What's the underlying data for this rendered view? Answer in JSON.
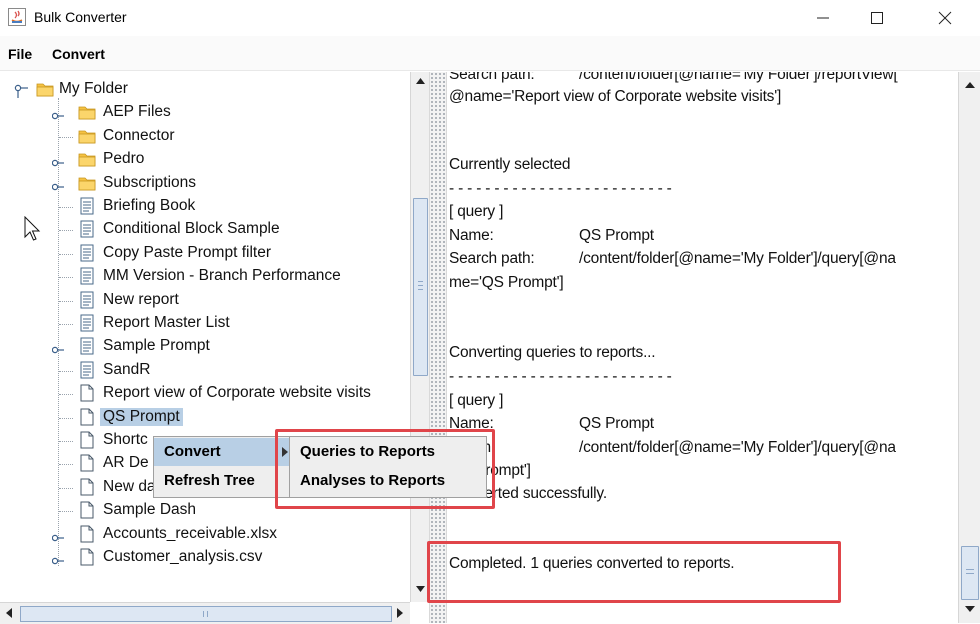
{
  "window": {
    "title": "Bulk Converter"
  },
  "menubar": {
    "file": "File",
    "convert": "Convert"
  },
  "tree": {
    "root": "My Folder",
    "items": [
      {
        "label": "AEP Files",
        "type": "folder",
        "expandable": true
      },
      {
        "label": "Connector",
        "type": "folder",
        "expandable": false
      },
      {
        "label": "Pedro",
        "type": "folder",
        "expandable": true
      },
      {
        "label": "Subscriptions",
        "type": "folder",
        "expandable": true
      },
      {
        "label": "Briefing Book",
        "type": "report",
        "expandable": false
      },
      {
        "label": "Conditional Block Sample",
        "type": "report",
        "expandable": false
      },
      {
        "label": "Copy Paste Prompt filter",
        "type": "report",
        "expandable": false
      },
      {
        "label": "MM Version - Branch Performance",
        "type": "report",
        "expandable": false
      },
      {
        "label": "New report",
        "type": "report",
        "expandable": false
      },
      {
        "label": "Report Master List",
        "type": "report",
        "expandable": false
      },
      {
        "label": "Sample Prompt",
        "type": "report",
        "expandable": true
      },
      {
        "label": "SandR",
        "type": "report",
        "expandable": false
      },
      {
        "label": "Report view of Corporate website visits",
        "type": "file",
        "expandable": false
      },
      {
        "label": "QS Prompt",
        "type": "file",
        "expandable": false,
        "selected": true
      },
      {
        "label": "Shortc",
        "type": "file",
        "expandable": false
      },
      {
        "label": "AR De",
        "type": "file",
        "expandable": false
      },
      {
        "label": "New dashboard",
        "type": "file",
        "expandable": false
      },
      {
        "label": "Sample Dash",
        "type": "file",
        "expandable": false
      },
      {
        "label": "Accounts_receivable.xlsx",
        "type": "file",
        "expandable": true
      },
      {
        "label": "Customer_analysis.csv",
        "type": "file",
        "expandable": true
      }
    ]
  },
  "context_menu": {
    "items": [
      "Convert",
      "Refresh Tree"
    ],
    "submenu": [
      "Queries to Reports",
      "Analyses to Reports"
    ]
  },
  "log": {
    "lines": [
      {
        "a": "Search path:",
        "b": "/content/folder[@name='My Folder']/reportView["
      },
      {
        "a": "@name='Report view of Corporate website visits']",
        "b": ""
      },
      {
        "a": "Currently selected",
        "b": ""
      },
      {
        "a": "- - - - - - - - - - - - - - - - - - - - - - - - -",
        "b": ""
      },
      {
        "a": "[ query ]",
        "b": ""
      },
      {
        "a": "Name:",
        "b": "QS Prompt"
      },
      {
        "a": "Search path:",
        "b": "/content/folder[@name='My Folder']/query[@na"
      },
      {
        "a": "me='QS Prompt']",
        "b": ""
      },
      {
        "a": "Converting queries to reports...",
        "b": ""
      },
      {
        "a": "- - - - - - - - - - - - - - - - - - - - - - - - -",
        "b": ""
      },
      {
        "a": "[ query ]",
        "b": ""
      },
      {
        "a": "Name:",
        "b": "QS Prompt"
      },
      {
        "a": "h path:",
        "b": "/content/folder[@name='My Folder']/query[@na"
      },
      {
        "a": "QS Prompt']",
        "b": ""
      },
      {
        "a": "Converted successfully.",
        "b": ""
      },
      {
        "a": "Completed. 1 queries converted to reports.",
        "b": ""
      }
    ]
  },
  "colors": {
    "highlight": "#e0454a",
    "selection": "#b8cfe5",
    "folder": "#f5c242"
  }
}
